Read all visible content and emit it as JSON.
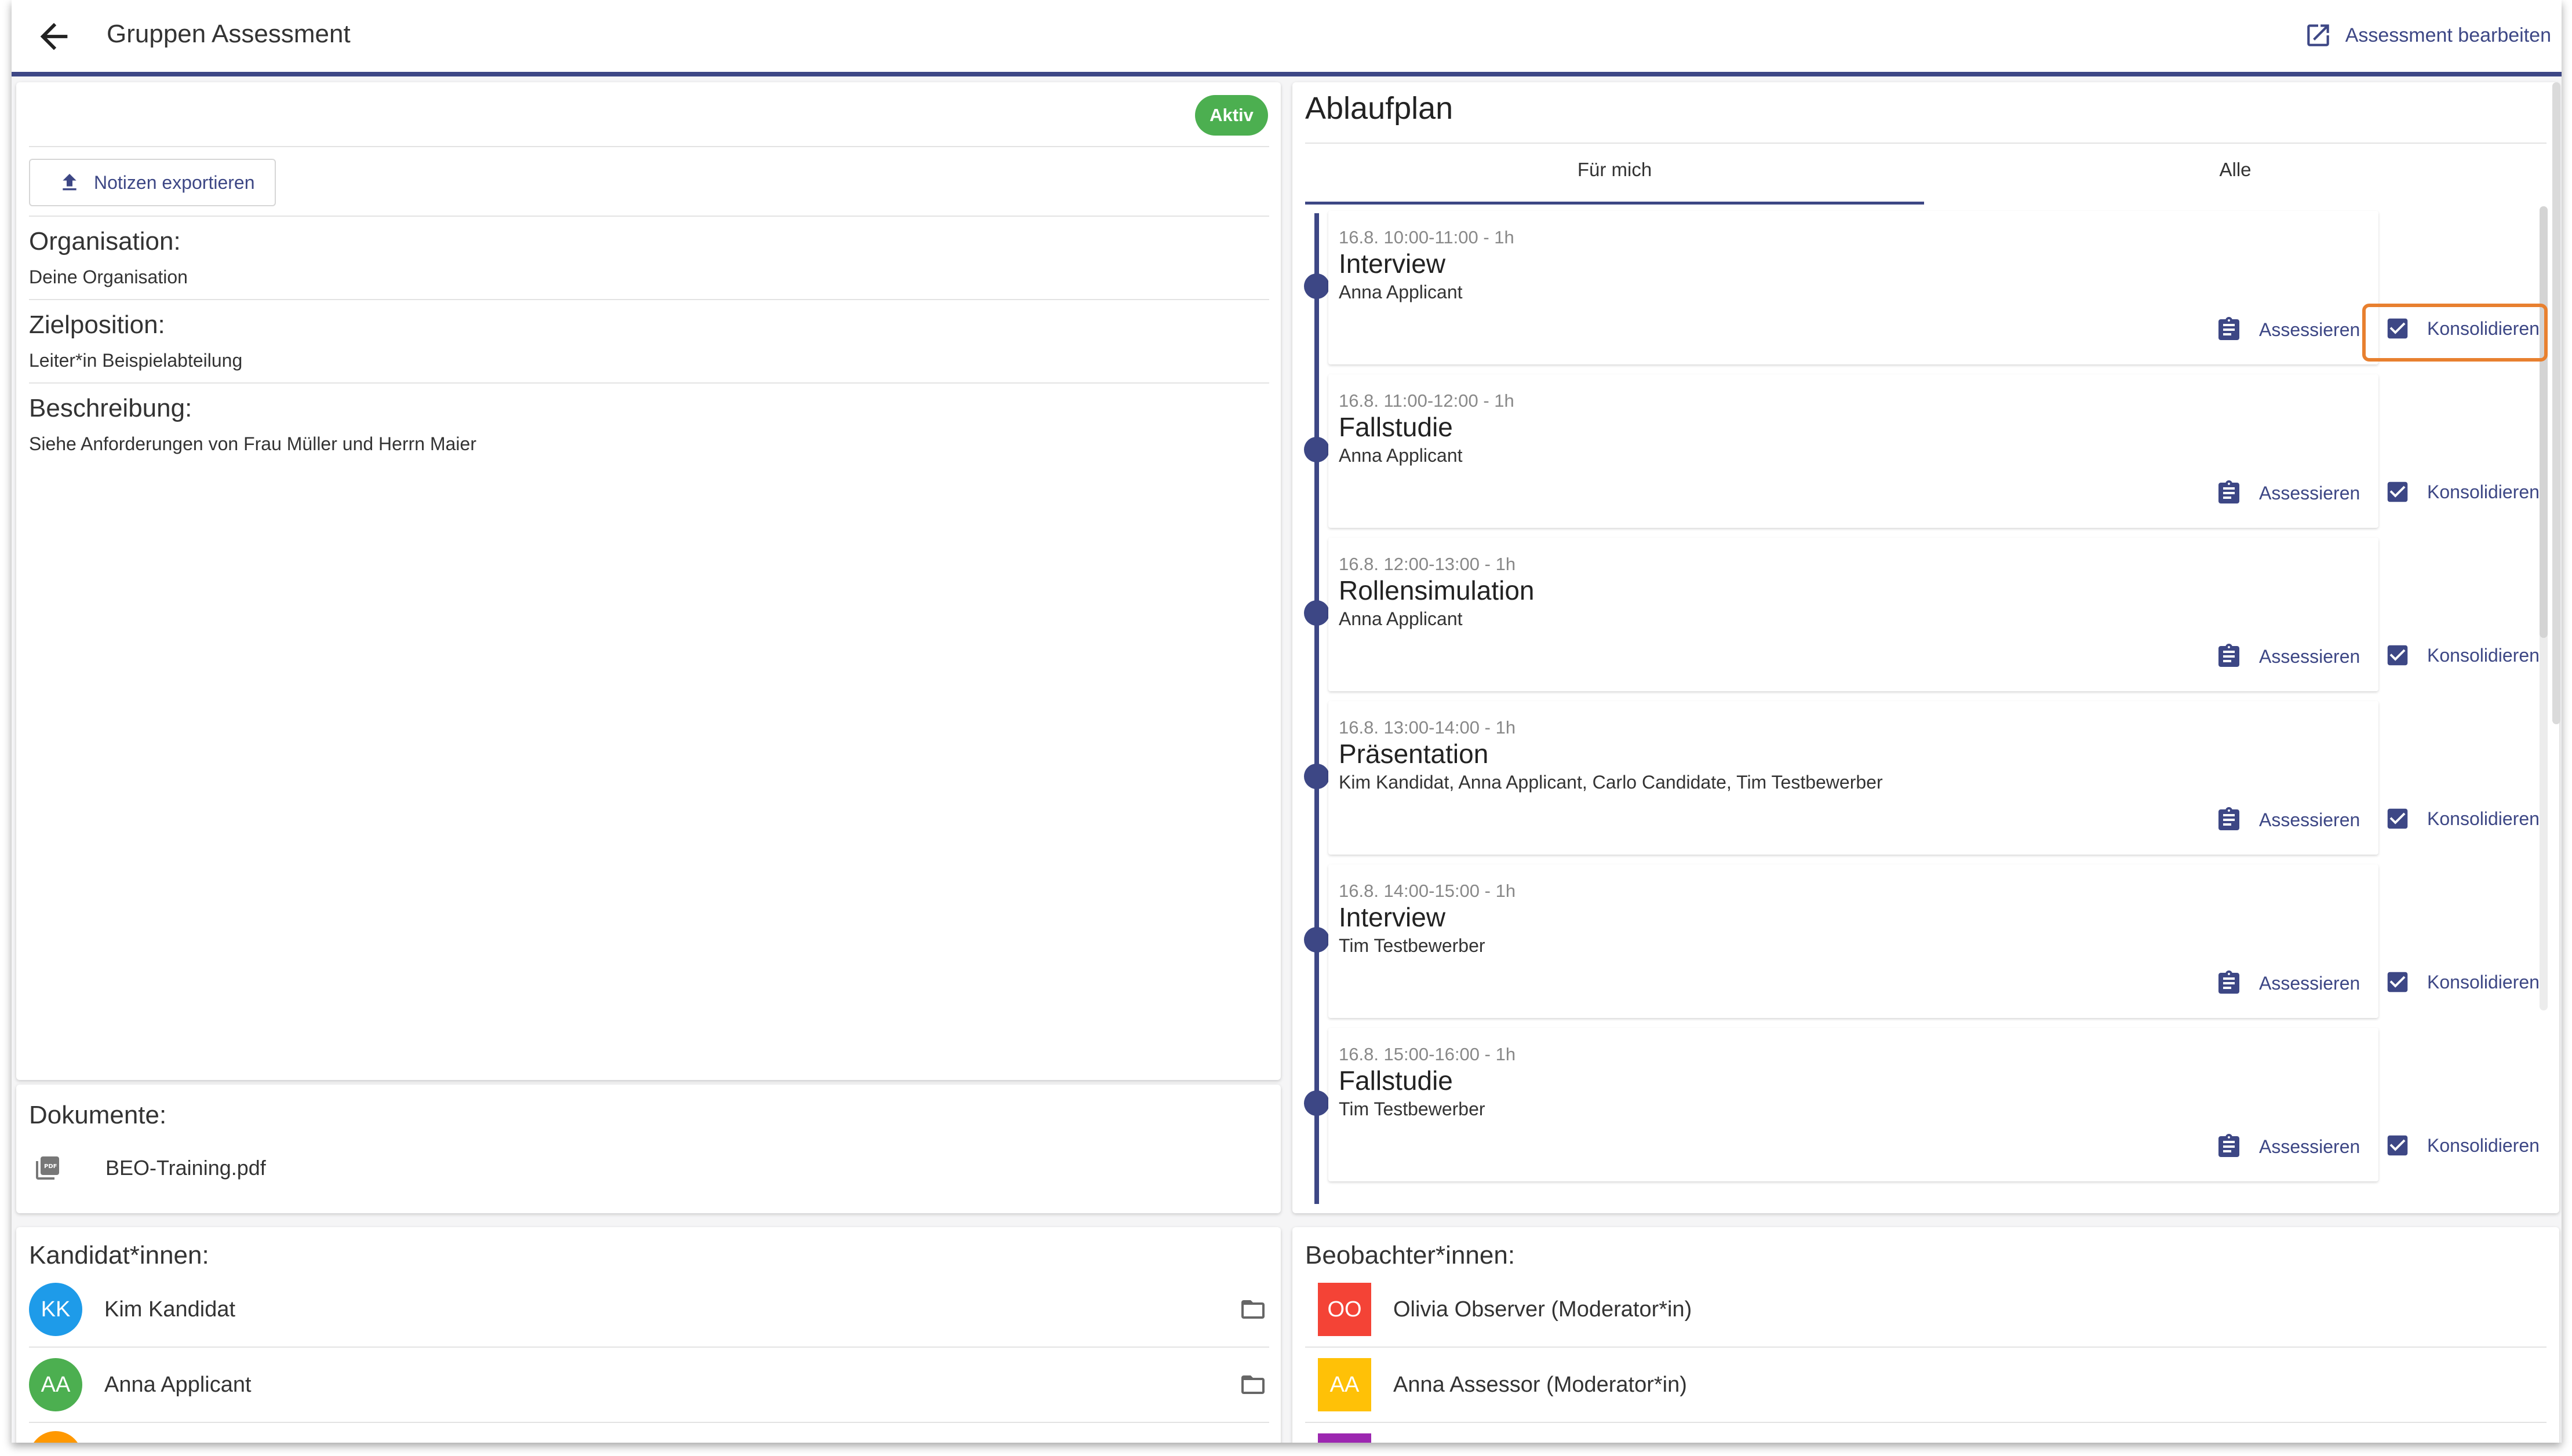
{
  "header": {
    "title": "Gruppen Assessment",
    "edit_label": "Assessment bearbeiten"
  },
  "details": {
    "status_badge": "Aktiv",
    "export_label": "Notizen exportieren",
    "fields": [
      {
        "label": "Organisation:",
        "value": "Deine Organisation"
      },
      {
        "label": "Zielposition:",
        "value": "Leiter*in Beispielabteilung"
      },
      {
        "label": "Beschreibung:",
        "value": "Siehe Anforderungen von Frau Müller und Herrn Maier"
      }
    ]
  },
  "documents": {
    "title": "Dokumente:",
    "items": [
      {
        "name": "BEO-Training.pdf",
        "icon": "pdf-file-icon"
      }
    ]
  },
  "schedule": {
    "title": "Ablaufplan",
    "tabs": [
      {
        "label": "Für mich",
        "active": true
      },
      {
        "label": "Alle",
        "active": false
      }
    ],
    "assess_label": "Assessieren",
    "consolidate_label": "Konsolidieren",
    "items": [
      {
        "time": "16.8. 10:00-11:00 - 1h",
        "name": "Interview",
        "people": "Anna Applicant"
      },
      {
        "time": "16.8. 11:00-12:00 - 1h",
        "name": "Fallstudie",
        "people": "Anna Applicant"
      },
      {
        "time": "16.8. 12:00-13:00 - 1h",
        "name": "Rollensimulation",
        "people": "Anna Applicant"
      },
      {
        "time": "16.8. 13:00-14:00 - 1h",
        "name": "Präsentation",
        "people": "Kim Kandidat, Anna Applicant, Carlo Candidate, Tim Testbewerber"
      },
      {
        "time": "16.8. 14:00-15:00 - 1h",
        "name": "Interview",
        "people": "Tim Testbewerber"
      },
      {
        "time": "16.8. 15:00-16:00 - 1h",
        "name": "Fallstudie",
        "people": "Tim Testbewerber"
      }
    ]
  },
  "candidates": {
    "title": "Kandidat*innen:",
    "items": [
      {
        "initials": "KK",
        "name": "Kim Kandidat",
        "color": "#1e9be9"
      },
      {
        "initials": "AA",
        "name": "Anna Applicant",
        "color": "#4caf50"
      }
    ]
  },
  "observers": {
    "title": "Beobachter*innen:",
    "items": [
      {
        "initials": "OO",
        "name": "Olivia Observer (Moderator*in)",
        "color": "#f44336"
      },
      {
        "initials": "AA",
        "name": "Anna Assessor (Moderator*in)",
        "color": "#ffc107"
      }
    ]
  },
  "colors": {
    "accent": "#3d4785",
    "status_active": "#4caf50",
    "highlight": "#e8802f"
  }
}
